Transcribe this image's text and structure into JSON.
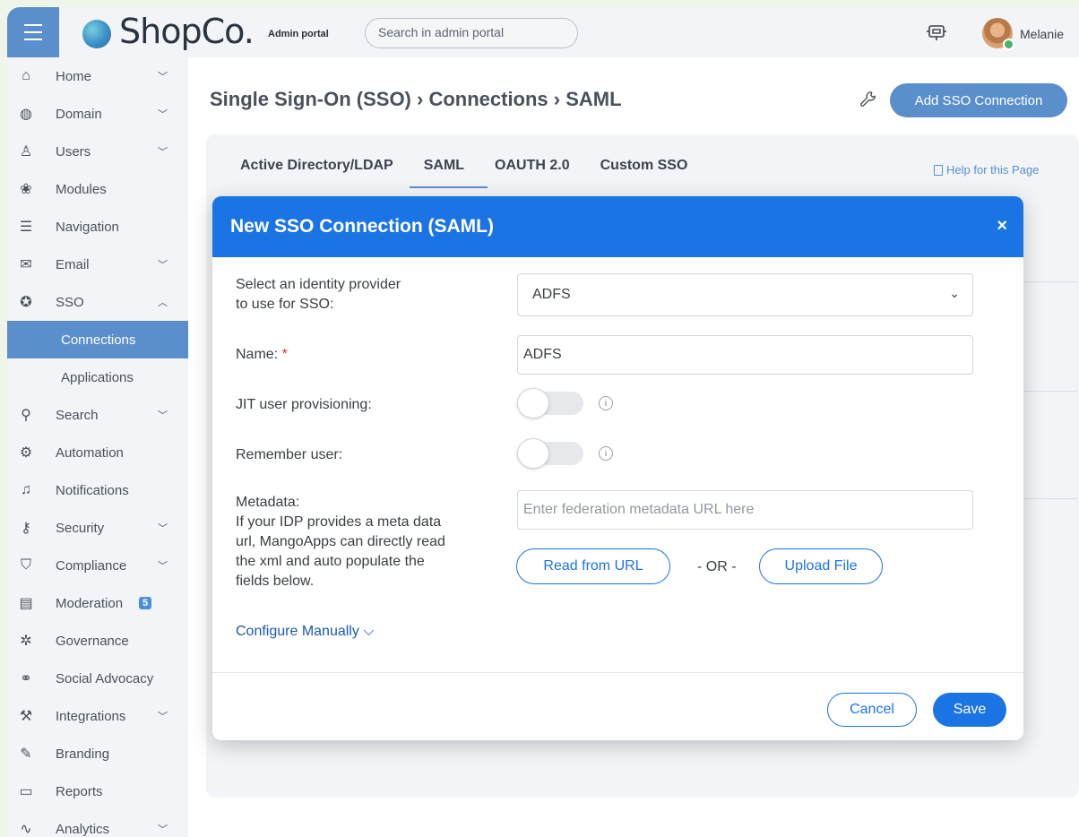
{
  "header": {
    "logo_text": "ShopCo.",
    "portal_label": "Admin portal",
    "search_placeholder": "Search in admin portal",
    "username": "Melanie"
  },
  "sidebar": {
    "items": [
      {
        "label": "Home",
        "icon": "home-icon",
        "chevron": "down"
      },
      {
        "label": "Domain",
        "icon": "globe-icon",
        "chevron": "down"
      },
      {
        "label": "Users",
        "icon": "user-icon",
        "chevron": "down"
      },
      {
        "label": "Modules",
        "icon": "modules-icon"
      },
      {
        "label": "Navigation",
        "icon": "list-icon"
      },
      {
        "label": "Email",
        "icon": "envelope-icon",
        "chevron": "down"
      },
      {
        "label": "SSO",
        "icon": "accessibility-icon",
        "chevron": "up"
      },
      {
        "label": "Connections",
        "sub": true,
        "active": true
      },
      {
        "label": "Applications",
        "sub": true
      },
      {
        "label": "Search",
        "icon": "search-icon",
        "chevron": "down"
      },
      {
        "label": "Automation",
        "icon": "gears-icon"
      },
      {
        "label": "Notifications",
        "icon": "bell-icon"
      },
      {
        "label": "Security",
        "icon": "key-icon",
        "chevron": "down"
      },
      {
        "label": "Compliance",
        "icon": "shield-icon",
        "chevron": "down"
      },
      {
        "label": "Moderation",
        "icon": "table-icon",
        "badge": "5"
      },
      {
        "label": "Governance",
        "icon": "cog-icon"
      },
      {
        "label": "Social Advocacy",
        "icon": "share-icon"
      },
      {
        "label": "Integrations",
        "icon": "wrench-icon",
        "chevron": "down"
      },
      {
        "label": "Branding",
        "icon": "brush-icon"
      },
      {
        "label": "Reports",
        "icon": "report-icon"
      },
      {
        "label": "Analytics",
        "icon": "chart-icon",
        "chevron": "down"
      }
    ]
  },
  "page": {
    "breadcrumb": "Single Sign-On (SSO) › Connections › SAML",
    "add_button": "Add SSO Connection",
    "help_link": "Help for this Page",
    "tabs": [
      "Active Directory/LDAP",
      "SAML",
      "OAUTH 2.0",
      "Custom SSO"
    ]
  },
  "modal": {
    "title": "New SSO Connection (SAML)",
    "close": "×",
    "idp_label_line1": "Select an identity provider",
    "idp_label_line2": "to use for SSO:",
    "idp_value": "ADFS",
    "name_label": "Name:",
    "name_required": "*",
    "name_value": "ADFS",
    "jit_label": "JIT user provisioning:",
    "remember_label": "Remember user:",
    "metadata_label": "Metadata:",
    "metadata_help_1": "If your IDP provides a meta data",
    "metadata_help_2": "url, MangoApps can directly read",
    "metadata_help_3": "the xml and auto populate the",
    "metadata_help_4": "fields below.",
    "metadata_placeholder": "Enter federation metadata URL here",
    "read_url_button": "Read from URL",
    "or_text": "- OR -",
    "upload_button": "Upload File",
    "configure_link": "Configure Manually",
    "cancel": "Cancel",
    "save": "Save"
  },
  "colors": {
    "accent": "#1b74e4",
    "sidebar_active": "#5b8fcb"
  }
}
